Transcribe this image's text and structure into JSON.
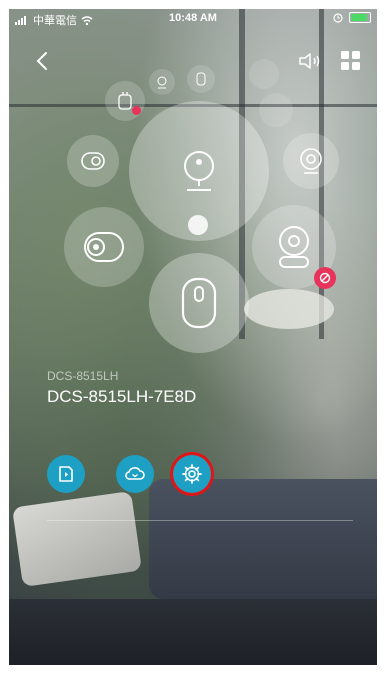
{
  "status_bar": {
    "carrier": "中華電信",
    "time": "10:48 AM"
  },
  "device": {
    "model": "DCS-8515LH",
    "name": "DCS-8515LH-7E8D"
  },
  "colors": {
    "accent": "#1e9fc4",
    "highlight_ring": "#e01616",
    "offline_badge": "#e8345a"
  },
  "icons": {
    "back": "chevron-left-icon",
    "sound": "speaker-icon",
    "grid": "grid-icon",
    "storage": "sd-card-icon",
    "cloud": "cloud-icon",
    "settings": "gear-icon"
  }
}
